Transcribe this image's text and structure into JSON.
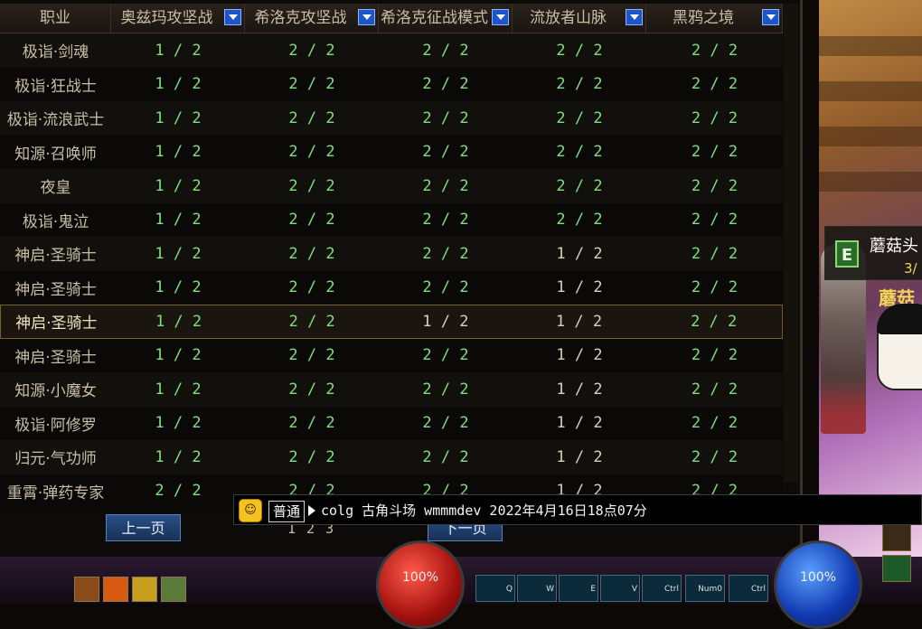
{
  "table": {
    "headers": [
      "职业",
      "奥兹玛攻坚战",
      "希洛克攻坚战",
      "希洛克征战模式",
      "流放者山脉",
      "黑鸦之境"
    ],
    "rows": [
      {
        "name": "极诣·剑魂",
        "v": [
          "1 / 2",
          "2 / 2",
          "2 / 2",
          "2 / 2",
          "2 / 2"
        ]
      },
      {
        "name": "极诣·狂战士",
        "v": [
          "1 / 2",
          "2 / 2",
          "2 / 2",
          "2 / 2",
          "2 / 2"
        ]
      },
      {
        "name": "极诣·流浪武士",
        "v": [
          "1 / 2",
          "2 / 2",
          "2 / 2",
          "2 / 2",
          "2 / 2"
        ]
      },
      {
        "name": "知源·召唤师",
        "v": [
          "1 / 2",
          "2 / 2",
          "2 / 2",
          "2 / 2",
          "2 / 2"
        ]
      },
      {
        "name": "夜皇",
        "v": [
          "1 / 2",
          "2 / 2",
          "2 / 2",
          "2 / 2",
          "2 / 2"
        ]
      },
      {
        "name": "极诣·鬼泣",
        "v": [
          "1 / 2",
          "2 / 2",
          "2 / 2",
          "2 / 2",
          "2 / 2"
        ]
      },
      {
        "name": "神启·圣骑士",
        "v": [
          "1 / 2",
          "2 / 2",
          "2 / 2",
          "1 / 2",
          "2 / 2"
        ]
      },
      {
        "name": "神启·圣骑士",
        "v": [
          "1 / 2",
          "2 / 2",
          "2 / 2",
          "1 / 2",
          "2 / 2"
        ]
      },
      {
        "name": "神启·圣骑士",
        "v": [
          "1 / 2",
          "2 / 2",
          "1 / 2",
          "1 / 2",
          "2 / 2"
        ]
      },
      {
        "name": "神启·圣骑士",
        "v": [
          "1 / 2",
          "2 / 2",
          "2 / 2",
          "1 / 2",
          "2 / 2"
        ]
      },
      {
        "name": "知源·小魔女",
        "v": [
          "1 / 2",
          "2 / 2",
          "2 / 2",
          "1 / 2",
          "2 / 2"
        ]
      },
      {
        "name": "极诣·阿修罗",
        "v": [
          "1 / 2",
          "2 / 2",
          "2 / 2",
          "1 / 2",
          "2 / 2"
        ]
      },
      {
        "name": "归元·气功师",
        "v": [
          "1 / 2",
          "2 / 2",
          "2 / 2",
          "1 / 2",
          "2 / 2"
        ]
      },
      {
        "name": "重霄·弹药专家",
        "v": [
          "2 / 2",
          "2 / 2",
          "2 / 2",
          "1 / 2",
          "2 / 2"
        ]
      }
    ]
  },
  "pagination": {
    "prev_label": "上一页",
    "next_label": "下一页",
    "pages": [
      "1",
      "2",
      "3"
    ]
  },
  "chat": {
    "channel": "普通",
    "emoji": "☺",
    "message": "colg 古角斗场 wmmmdev 2022年4月16日18点07分"
  },
  "side_art": {
    "line1": "蘑菇头",
    "line2": "3/",
    "line3": "蘑菇",
    "badge": "E"
  },
  "hud": {
    "hp_label": "100%",
    "mp_label": "100%",
    "keys": [
      "Q",
      "W",
      "E",
      "V",
      "Ctrl",
      "Num0",
      "Ctrl"
    ]
  }
}
